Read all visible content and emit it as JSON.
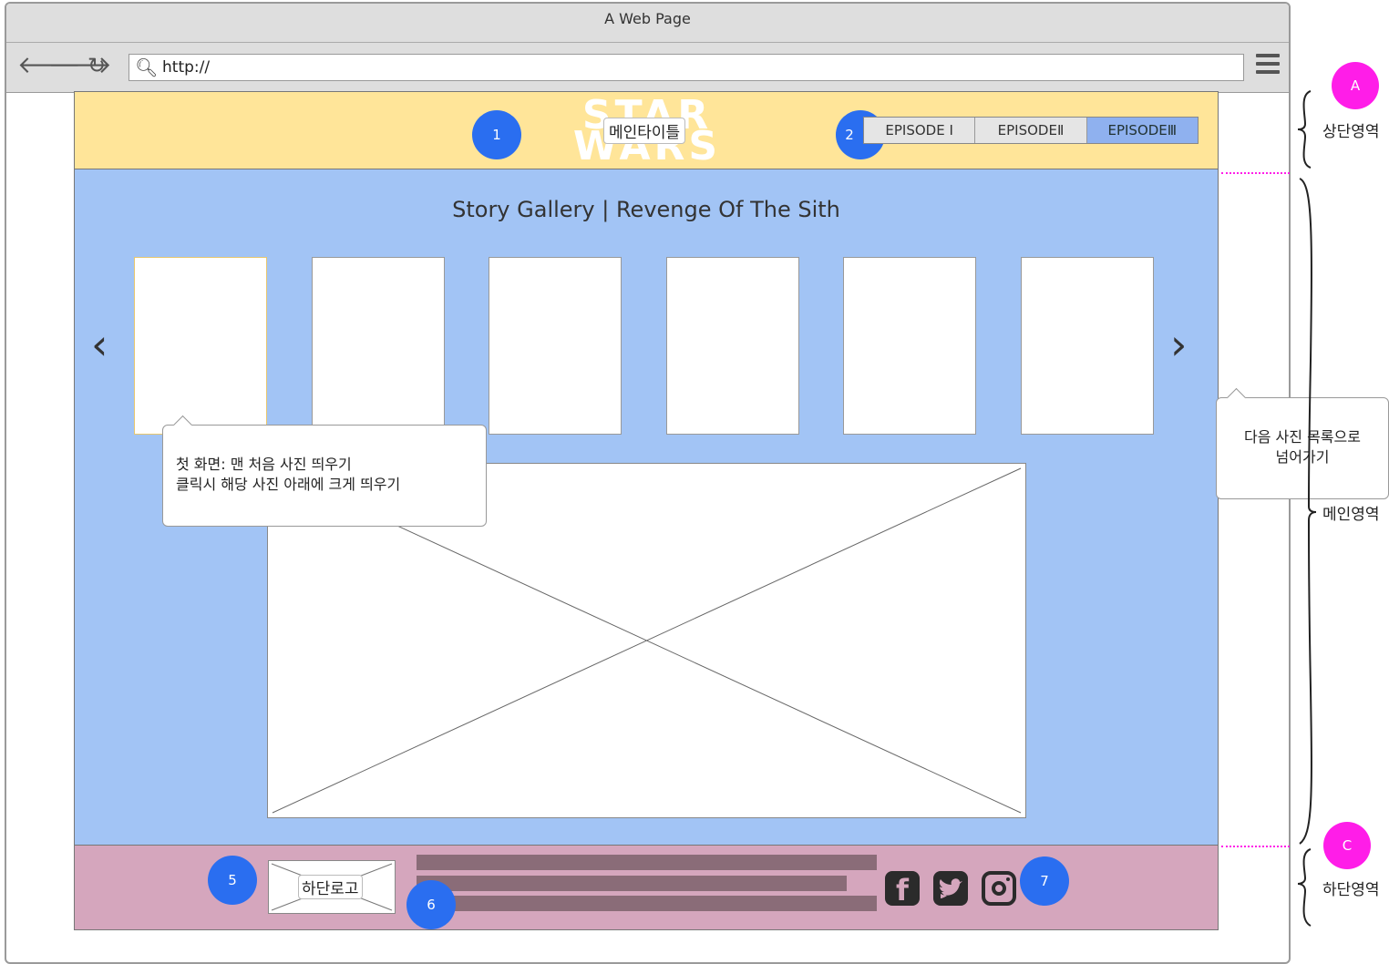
{
  "window": {
    "title": "A Web Page",
    "url": "http://"
  },
  "header": {
    "logo_text_top": "STAR",
    "logo_text_bottom": "WARS",
    "main_title_label": "메인타이틀",
    "badge_1": "1",
    "badge_2": "2",
    "episodes": [
      {
        "label": "EPISODE Ⅰ",
        "active": false
      },
      {
        "label": "EPISODEⅡ",
        "active": false
      },
      {
        "label": "EPISODEⅢ",
        "active": true
      }
    ]
  },
  "main": {
    "gallery_title": "Story Gallery | Revenge Of The Sith",
    "prev_arrow": "‹",
    "next_arrow": "›",
    "thumbnail_count": 6,
    "callout_first_line1": "첫 화면: 맨 처음 사진 띄우기",
    "callout_first_line2": "클릭시 해당 사진 아래에 크게 띄우기",
    "callout_next_line1": "다음 사진 목록으로",
    "callout_next_line2": "넘어가기"
  },
  "footer": {
    "logo_label": "하단로고",
    "badge_5": "5",
    "badge_6": "6",
    "badge_7": "7",
    "social_icons": [
      "facebook-icon",
      "twitter-icon",
      "instagram-icon"
    ]
  },
  "annotations": {
    "badge_a": "A",
    "badge_c": "C",
    "top_region": "상단영역",
    "main_region": "메인영역",
    "bottom_region": "하단영역"
  },
  "colors": {
    "header_bg": "#ffe599",
    "main_bg": "#a2c4f5",
    "footer_bg": "#d5a6bd",
    "badge_blue": "#2a6ef0",
    "badge_pink": "#ff1de8"
  }
}
